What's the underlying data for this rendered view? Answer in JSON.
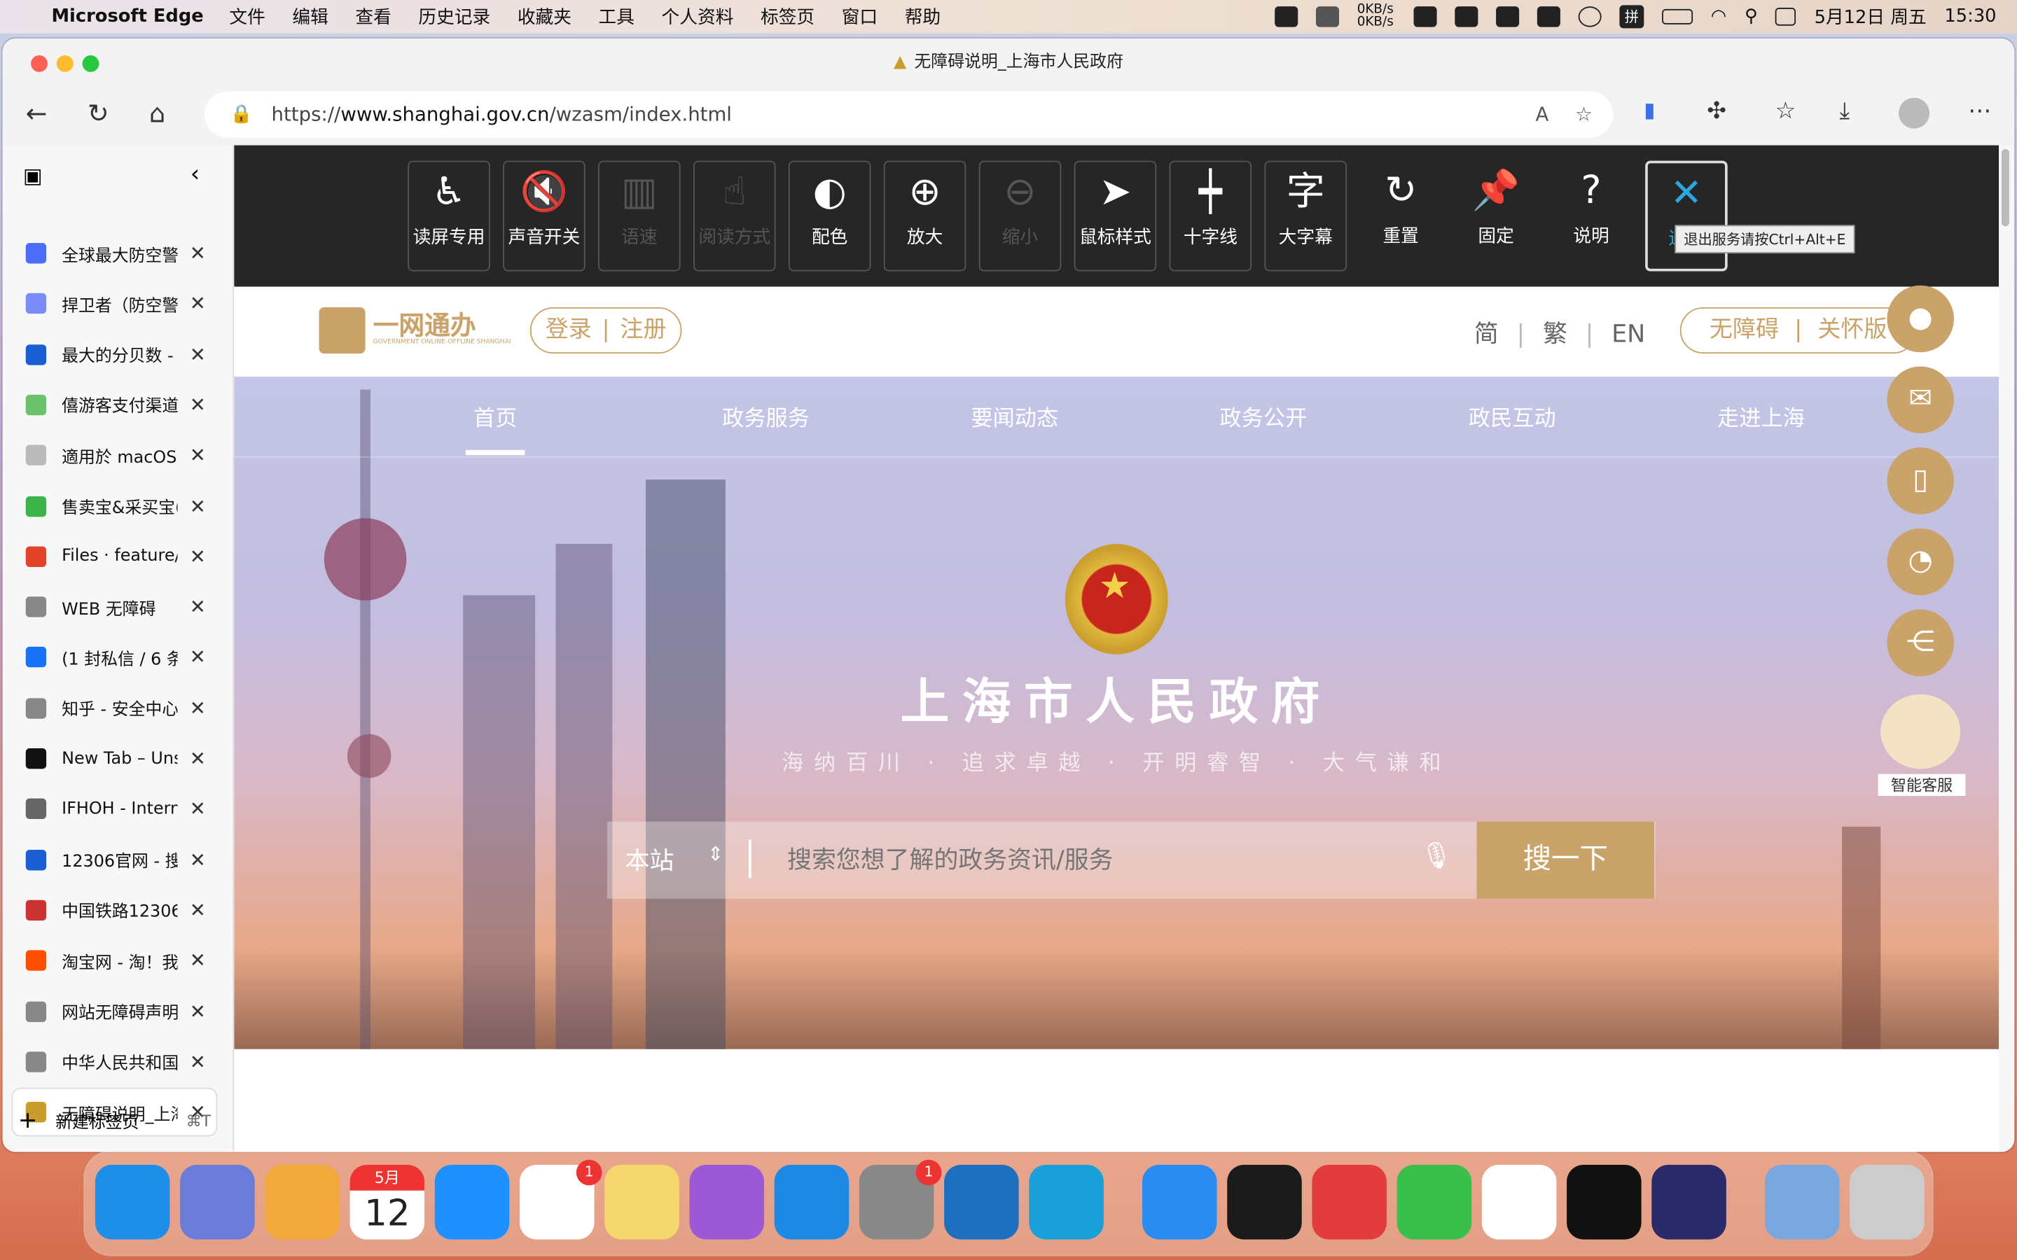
{
  "menubar": {
    "app": "Microsoft Edge",
    "items": [
      "文件",
      "编辑",
      "查看",
      "历史记录",
      "收藏夹",
      "工具",
      "个人资料",
      "标签页",
      "窗口",
      "帮助"
    ],
    "netspeed": "0KB/s 0KB/s",
    "ime": "拼",
    "date": "5月12日 周五",
    "time": "15:30"
  },
  "window": {
    "title": "无障碍说明_上海市人民政府",
    "url_prefix": "https://",
    "url_domain": "www.shanghai.gov.cn",
    "url_path": "/wzasm/index.html"
  },
  "sidebar": {
    "tabs": [
      {
        "label": "全球最大防空警",
        "icon": "paw-icon",
        "color": "#4a6cf7"
      },
      {
        "label": "捍卫者（防空警",
        "icon": "paw-icon",
        "color": "#7a8cf7"
      },
      {
        "label": "最大的分贝数 -",
        "icon": "search-icon",
        "color": "#1a5fd1"
      },
      {
        "label": "僖游客支付渠道",
        "icon": "app-icon",
        "color": "#6cc26c"
      },
      {
        "label": "適用於 macOS",
        "icon": "app-icon",
        "color": "#bbb"
      },
      {
        "label": "售卖宝&采买宝(",
        "icon": "app-icon",
        "color": "#3bb54a"
      },
      {
        "label": "Files · feature/",
        "icon": "gitlab-icon",
        "color": "#e24329"
      },
      {
        "label": "WEB 无障碍",
        "icon": "page-icon",
        "color": "#888"
      },
      {
        "label": "(1 封私信 / 6 条",
        "icon": "zhihu-icon",
        "color": "#1772f6"
      },
      {
        "label": "知乎 - 安全中心",
        "icon": "page-icon",
        "color": "#888"
      },
      {
        "label": "New Tab – Uns",
        "icon": "app-icon",
        "color": "#111"
      },
      {
        "label": "IFHOH - Intern",
        "icon": "app-icon",
        "color": "#666"
      },
      {
        "label": "12306官网 - 搜",
        "icon": "search-icon",
        "color": "#1a5fd1"
      },
      {
        "label": "中国铁路12306",
        "icon": "rail-icon",
        "color": "#c33"
      },
      {
        "label": "淘宝网 - 淘！我",
        "icon": "taobao-icon",
        "color": "#ff5000"
      },
      {
        "label": "网站无障碍声明",
        "icon": "page-icon",
        "color": "#888"
      },
      {
        "label": "中华人民共和国",
        "icon": "page-icon",
        "color": "#888"
      },
      {
        "label": "无障碍说明_上海",
        "icon": "emblem-icon",
        "color": "#c99c2e"
      }
    ],
    "new_tab": "新建标签页",
    "new_tab_shortcut": "⌘T"
  },
  "a11y": {
    "buttons": [
      {
        "label": "读屏专用",
        "glyph": "♿",
        "state": "normal"
      },
      {
        "label": "声音开关",
        "glyph": "🔇",
        "state": "normal"
      },
      {
        "label": "语速",
        "glyph": "▥",
        "state": "disabled"
      },
      {
        "label": "阅读方式",
        "glyph": "☝",
        "state": "disabled"
      },
      {
        "label": "配色",
        "glyph": "◐",
        "state": "normal"
      },
      {
        "label": "放大",
        "glyph": "⊕",
        "state": "normal"
      },
      {
        "label": "缩小",
        "glyph": "⊖",
        "state": "disabled"
      },
      {
        "label": "鼠标样式",
        "glyph": "➤",
        "state": "normal"
      },
      {
        "label": "十字线",
        "glyph": "┿",
        "state": "normal"
      },
      {
        "label": "大字幕",
        "glyph": "字",
        "state": "normal"
      },
      {
        "label": "重置",
        "glyph": "↻",
        "state": "plain"
      },
      {
        "label": "固定",
        "glyph": "📌",
        "state": "plain"
      },
      {
        "label": "说明",
        "glyph": "?",
        "state": "plain"
      },
      {
        "label": "退出",
        "glyph": "✕",
        "state": "selected"
      }
    ],
    "tooltip": "退出服务请按Ctrl+Alt+E"
  },
  "site": {
    "logo": "一网通办",
    "logo_sub": "GOVERNMENT ONLINE-OFFLINE SHANGHAI",
    "login": "登录",
    "register": "注册",
    "langs": [
      "简",
      "繁",
      "EN"
    ],
    "mode_a11y": "无障碍",
    "mode_care": "关怀版",
    "nav": [
      "首页",
      "政务服务",
      "要闻动态",
      "政务公开",
      "政民互动",
      "走进上海"
    ],
    "title": "上海市人民政府",
    "slogan": "海纳百川 · 追求卓越 · 开明睿智 · 大气谦和",
    "search_scope": "本站",
    "search_placeholder": "搜索您想了解的政务资讯/服务",
    "search_button": "搜一下",
    "assistant": "智能客服"
  },
  "dock": {
    "apps": [
      "Finder",
      "Launchpad",
      "Photos",
      "Calendar",
      "Safari",
      "Reminders",
      "Notes",
      "Podcasts",
      "App Store",
      "System Settings",
      "VS Code",
      "Edge",
      "Feishu",
      "Parallels",
      "NetEase Music",
      "WeChat",
      "TextEdit",
      "Terminal",
      "1Password",
      "Downloads",
      "Trash"
    ],
    "calendar_month": "5月",
    "calendar_day": "12",
    "badges": {
      "reminders": "1",
      "settings": "1"
    }
  }
}
